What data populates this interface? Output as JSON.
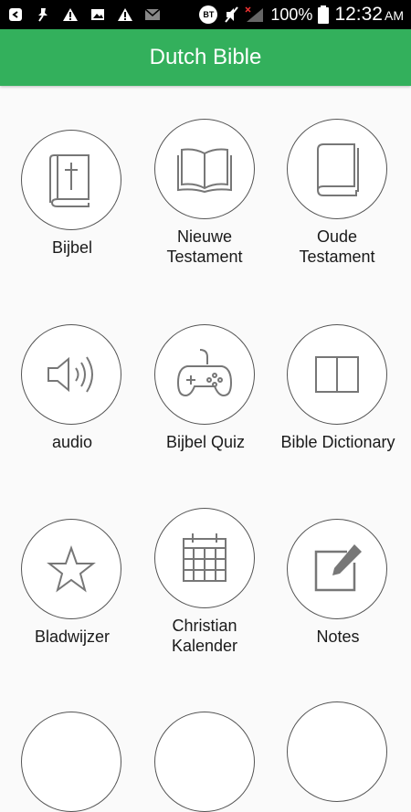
{
  "status_bar": {
    "battery": "100%",
    "time": "12:32",
    "ampm": "AM",
    "bt_label": "BT"
  },
  "header": {
    "title": "Dutch Bible"
  },
  "menu": {
    "items": [
      {
        "label": "Bijbel",
        "icon": "bible-cross-icon"
      },
      {
        "label": "Nieuwe Testament",
        "icon": "open-book-icon"
      },
      {
        "label": "Oude Testament",
        "icon": "closed-book-icon"
      },
      {
        "label": "audio",
        "icon": "speaker-icon"
      },
      {
        "label": "Bijbel Quiz",
        "icon": "gamepad-icon"
      },
      {
        "label": "Bible Dictionary",
        "icon": "book-outline-icon"
      },
      {
        "label": "Bladwijzer",
        "icon": "star-icon"
      },
      {
        "label": "Christian Kalender",
        "icon": "calendar-icon"
      },
      {
        "label": "Notes",
        "icon": "edit-note-icon"
      }
    ]
  }
}
